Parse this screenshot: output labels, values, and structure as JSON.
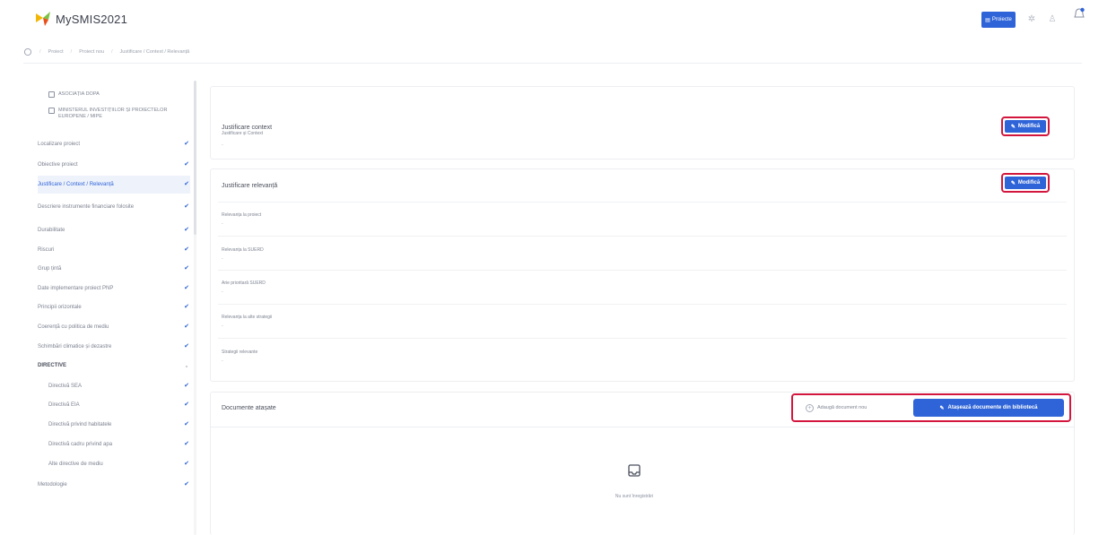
{
  "app": {
    "title": "MySMIS2021"
  },
  "topbar": {
    "projects_button": "Proiecte"
  },
  "breadcrumb": [
    "Proiect",
    "Proiect nou",
    "Justificare / Context / Relevanță"
  ],
  "sidebar": {
    "headers": [
      "ASOCIAȚIA DOPA",
      "MINISTERUL INVESTIȚIILOR ȘI PROIECTELOR EUROPENE / MIPE"
    ],
    "items": [
      {
        "label": "Localizare proiect",
        "checked": true
      },
      {
        "label": "Obiective proiect",
        "checked": true
      },
      {
        "label": "Justificare / Context / Relevanță",
        "checked": true,
        "active": true
      },
      {
        "label": "Descriere instrumente financiare folosite",
        "checked": true
      },
      {
        "label": "Durabilitate",
        "checked": true
      },
      {
        "label": "Riscuri",
        "checked": true
      },
      {
        "label": "Grup țintă",
        "checked": true
      },
      {
        "label": "Date implementare proiect PNP",
        "checked": true
      },
      {
        "label": "Principii orizontale",
        "checked": true
      },
      {
        "label": "Coerență cu politica de mediu",
        "checked": true
      },
      {
        "label": "Schimbări climatice și dezastre",
        "checked": true
      }
    ],
    "group": {
      "label": "DIRECTIVE"
    },
    "subitems": [
      {
        "label": "Directivă SEA",
        "checked": true
      },
      {
        "label": "Directivă EIA",
        "checked": true
      },
      {
        "label": "Directivă privind habitatele",
        "checked": true
      },
      {
        "label": "Directivă cadru privind apa",
        "checked": true
      },
      {
        "label": "Alte directive de mediu",
        "checked": true
      }
    ],
    "last_item": {
      "label": "Metodologie",
      "checked": true
    }
  },
  "context_card": {
    "title": "Justificare context",
    "modify_label": "Modifică",
    "field_label": "Justificare și Context",
    "field_value": "-"
  },
  "relevance_card": {
    "title": "Justificare relevanță",
    "modify_label": "Modifică",
    "fields": [
      {
        "label": "Relevanța la proiect",
        "value": "-"
      },
      {
        "label": "Relevanța la SUERD",
        "value": "-"
      },
      {
        "label": "Arie prioritară SUERD",
        "value": "-"
      },
      {
        "label": "Relevanța la alte strategii",
        "value": "-"
      },
      {
        "label": "Strategii relevante",
        "value": "-"
      }
    ]
  },
  "documents_card": {
    "title": "Documente atașate",
    "add_new_label": "Adaugă document nou",
    "library_label": "Atașează documente din bibliotecă",
    "empty_text": "Nu sunt înregistrări"
  },
  "colors": {
    "accent": "#2f64d8",
    "highlight": "#d3163d"
  }
}
